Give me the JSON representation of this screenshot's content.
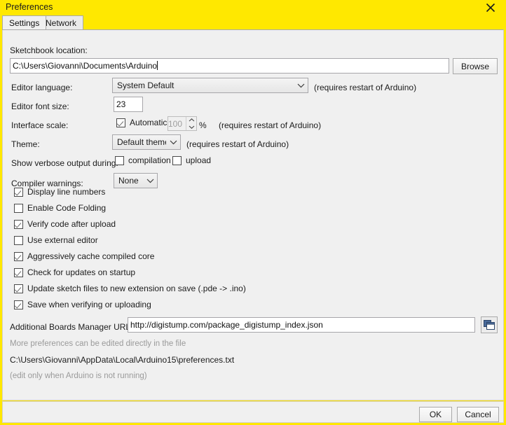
{
  "window": {
    "title": "Preferences",
    "close_icon": "close-icon",
    "accent_color": "#ffe800",
    "panel_color": "#f0f0f0"
  },
  "tabs": [
    {
      "label": "Settings",
      "active": true
    },
    {
      "label": "Network",
      "active": false
    }
  ],
  "sketchbook": {
    "label": "Sketchbook location:",
    "value": "C:\\Users\\Giovanni\\Documents\\Arduino",
    "browse_label": "Browse"
  },
  "editor_language": {
    "label": "Editor language:",
    "value": "System Default",
    "note": "(requires restart of Arduino)"
  },
  "editor_font_size": {
    "label": "Editor font size:",
    "value": "23"
  },
  "interface_scale": {
    "label": "Interface scale:",
    "automatic_label": "Automatic",
    "automatic_checked": true,
    "value": "100",
    "percent": "%",
    "note": "(requires restart of Arduino)"
  },
  "theme": {
    "label": "Theme:",
    "value": "Default theme",
    "note": "(requires restart of Arduino)"
  },
  "verbose": {
    "label": "Show verbose output during:",
    "compilation_label": "compilation",
    "compilation_checked": false,
    "upload_label": "upload",
    "upload_checked": false
  },
  "compiler_warnings": {
    "label": "Compiler warnings:",
    "value": "None"
  },
  "options": [
    {
      "label": "Display line numbers",
      "checked": true
    },
    {
      "label": "Enable Code Folding",
      "checked": false
    },
    {
      "label": "Verify code after upload",
      "checked": true
    },
    {
      "label": "Use external editor",
      "checked": false
    },
    {
      "label": "Aggressively cache compiled core",
      "checked": true
    },
    {
      "label": "Check for updates on startup",
      "checked": true
    },
    {
      "label": "Update sketch files to new extension on save (.pde -> .ino)",
      "checked": true
    },
    {
      "label": "Save when verifying or uploading",
      "checked": true
    }
  ],
  "boards_urls": {
    "label": "Additional Boards Manager URLs:",
    "value": "http://digistump.com/package_digistump_index.json",
    "icon": "open-list-icon"
  },
  "footer": {
    "more_prefs": "More preferences can be edited directly in the file",
    "prefs_path": "C:\\Users\\Giovanni\\AppData\\Local\\Arduino15\\preferences.txt",
    "edit_note": "(edit only when Arduino is not running)"
  },
  "buttons": {
    "ok": "OK",
    "cancel": "Cancel"
  }
}
